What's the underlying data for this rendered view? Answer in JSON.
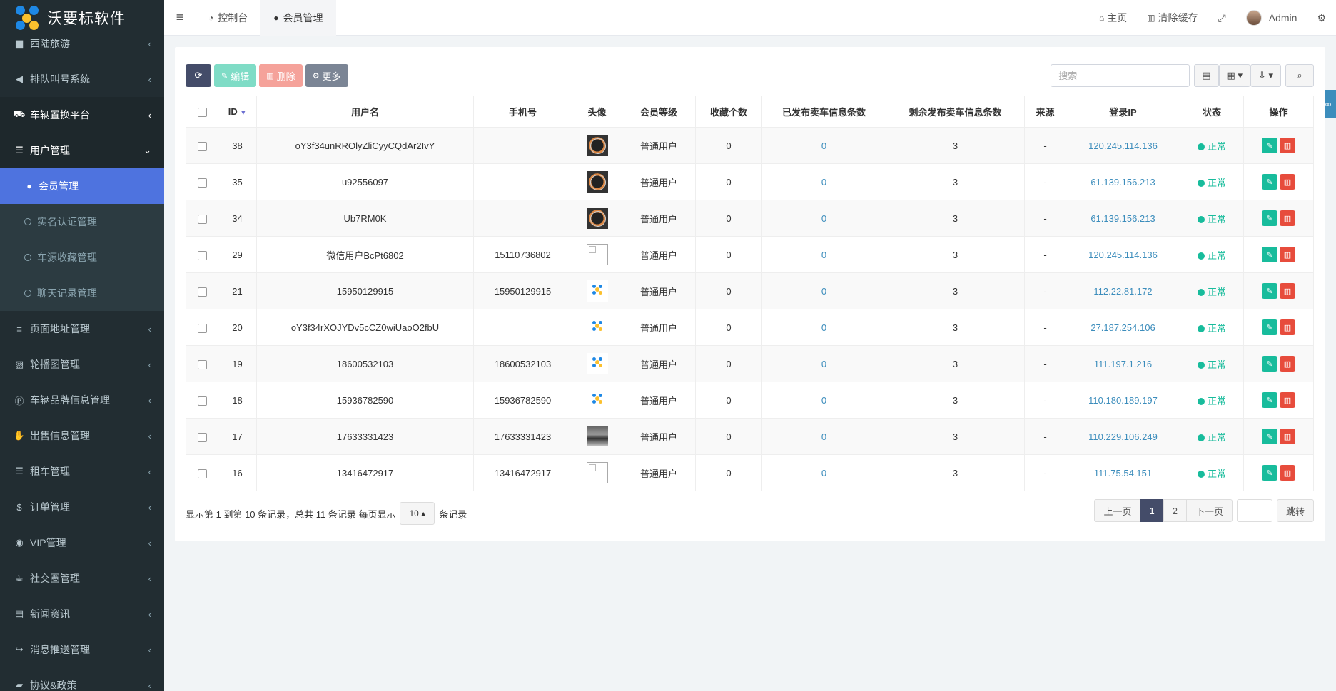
{
  "app": {
    "title": "沃要标软件"
  },
  "sidebar": {
    "items": [
      {
        "label": "西陆旅游",
        "icon": "folder-icon",
        "glyph": "▆"
      },
      {
        "label": "排队叫号系统",
        "icon": "bullhorn-icon",
        "glyph": "📢"
      },
      {
        "label": "车辆置换平台",
        "icon": "car-icon",
        "glyph": "🚘"
      },
      {
        "label": "用户管理",
        "icon": "list-icon",
        "glyph": "☰"
      },
      {
        "label": "页面地址管理",
        "icon": "bars-icon",
        "glyph": "≡"
      },
      {
        "label": "轮播图管理",
        "icon": "image-icon",
        "glyph": "▨"
      },
      {
        "label": "车辆品牌信息管理",
        "icon": "product-hunt-icon",
        "glyph": "Ⓟ"
      },
      {
        "label": "出售信息管理",
        "icon": "handshake-icon",
        "glyph": "✋"
      },
      {
        "label": "租车管理",
        "icon": "list-icon",
        "glyph": "☰"
      },
      {
        "label": "订单管理",
        "icon": "dollar-icon",
        "glyph": "$"
      },
      {
        "label": "VIP管理",
        "icon": "user-circle-icon",
        "glyph": "◉"
      },
      {
        "label": "社交圈管理",
        "icon": "coffee-icon",
        "glyph": "☕"
      },
      {
        "label": "新闻资讯",
        "icon": "file-icon",
        "glyph": "▤"
      },
      {
        "label": "消息推送管理",
        "icon": "share-icon",
        "glyph": "↪"
      },
      {
        "label": "协议&政策",
        "icon": "book-icon",
        "glyph": "▰"
      }
    ],
    "sub_items": [
      {
        "label": "会员管理",
        "icon": "user-icon"
      },
      {
        "label": "实名认证管理",
        "icon": "circle-icon"
      },
      {
        "label": "车源收藏管理",
        "icon": "circle-icon"
      },
      {
        "label": "聊天记录管理",
        "icon": "circle-icon"
      }
    ]
  },
  "topbar": {
    "tabs": [
      {
        "label": "控制台",
        "icon": "dashboard-icon"
      },
      {
        "label": "会员管理",
        "icon": "user-icon"
      }
    ],
    "home": "主页",
    "clear_cache": "清除缓存",
    "admin": "Admin"
  },
  "toolbar": {
    "edit": "编辑",
    "delete": "删除",
    "more": "更多",
    "search_placeholder": "搜索"
  },
  "table": {
    "headers": [
      "ID",
      "用户名",
      "手机号",
      "头像",
      "会员等级",
      "收藏个数",
      "已发布卖车信息条数",
      "剩余发布卖车信息条数",
      "来源",
      "登录IP",
      "状态",
      "操作"
    ],
    "rows": [
      {
        "id": "38",
        "username": "oY3f34unRROlyZliCyyCQdAr2IvY",
        "phone": "",
        "avatar": "merc",
        "level": "普通用户",
        "fav": "0",
        "published": "0",
        "remaining": "3",
        "source": "-",
        "ip": "120.245.114.136",
        "status": "正常"
      },
      {
        "id": "35",
        "username": "u92556097",
        "phone": "",
        "avatar": "merc",
        "level": "普通用户",
        "fav": "0",
        "published": "0",
        "remaining": "3",
        "source": "-",
        "ip": "61.139.156.213",
        "status": "正常"
      },
      {
        "id": "34",
        "username": "Ub7RM0K",
        "phone": "",
        "avatar": "merc",
        "level": "普通用户",
        "fav": "0",
        "published": "0",
        "remaining": "3",
        "source": "-",
        "ip": "61.139.156.213",
        "status": "正常"
      },
      {
        "id": "29",
        "username": "微信用户BcPt6802",
        "phone": "15110736802",
        "avatar": "broken",
        "level": "普通用户",
        "fav": "0",
        "published": "0",
        "remaining": "3",
        "source": "-",
        "ip": "120.245.114.136",
        "status": "正常"
      },
      {
        "id": "21",
        "username": "15950129915",
        "phone": "15950129915",
        "avatar": "logo",
        "level": "普通用户",
        "fav": "0",
        "published": "0",
        "remaining": "3",
        "source": "-",
        "ip": "112.22.81.172",
        "status": "正常"
      },
      {
        "id": "20",
        "username": "oY3f34rXOJYDv5cCZ0wiUaoO2fbU",
        "phone": "",
        "avatar": "logo",
        "level": "普通用户",
        "fav": "0",
        "published": "0",
        "remaining": "3",
        "source": "-",
        "ip": "27.187.254.106",
        "status": "正常"
      },
      {
        "id": "19",
        "username": "18600532103",
        "phone": "18600532103",
        "avatar": "logo",
        "level": "普通用户",
        "fav": "0",
        "published": "0",
        "remaining": "3",
        "source": "-",
        "ip": "111.197.1.216",
        "status": "正常"
      },
      {
        "id": "18",
        "username": "15936782590",
        "phone": "15936782590",
        "avatar": "logo",
        "level": "普通用户",
        "fav": "0",
        "published": "0",
        "remaining": "3",
        "source": "-",
        "ip": "110.180.189.197",
        "status": "正常"
      },
      {
        "id": "17",
        "username": "17633331423",
        "phone": "17633331423",
        "avatar": "car",
        "level": "普通用户",
        "fav": "0",
        "published": "0",
        "remaining": "3",
        "source": "-",
        "ip": "110.229.106.249",
        "status": "正常"
      },
      {
        "id": "16",
        "username": "13416472917",
        "phone": "13416472917",
        "avatar": "broken",
        "level": "普通用户",
        "fav": "0",
        "published": "0",
        "remaining": "3",
        "source": "-",
        "ip": "111.75.54.151",
        "status": "正常"
      }
    ]
  },
  "footer": {
    "info_prefix": "显示第 1 到第 10 条记录，总共 11 条记录 每页显示",
    "page_size": "10",
    "info_suffix": "条记录",
    "prev": "上一页",
    "pages": [
      "1",
      "2"
    ],
    "next": "下一页",
    "jump": "跳转"
  },
  "colors": {
    "accent": "#4e73df",
    "sidebar_bg": "#222d32",
    "status_green": "#18bc9c",
    "danger": "#e74c3c"
  }
}
